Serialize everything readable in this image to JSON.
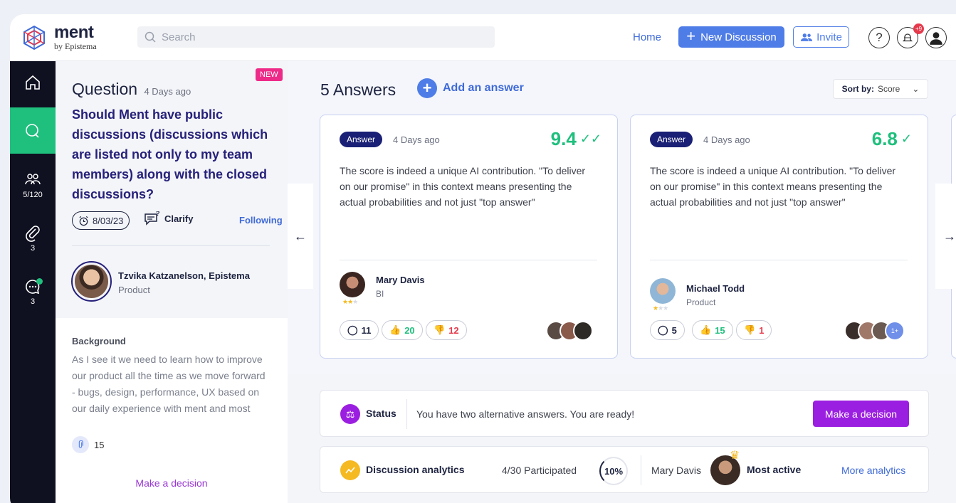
{
  "app": {
    "name": "ment",
    "sub": "by Epistema",
    "search_placeholder": "Search",
    "nav_home": "Home",
    "new_discussion": "New Discussion",
    "invite": "Invite",
    "help_icon": "?",
    "notification_count": "+9"
  },
  "sidebar": {
    "items": [
      {
        "name": "home-icon",
        "count": ""
      },
      {
        "name": "question-icon",
        "count": ""
      },
      {
        "name": "participants-icon",
        "count": "5/120"
      },
      {
        "name": "attachment-icon",
        "count": "3"
      },
      {
        "name": "chat-icon",
        "count": "3"
      }
    ]
  },
  "question": {
    "badge": "NEW",
    "heading": "Question",
    "time": "4 Days ago",
    "title": "Should Ment have public discussions (discussions which are listed not only to my team members) along with the  closed discussions?",
    "date": "8/03/23",
    "clarify": "Clarify",
    "following": "Following",
    "author_name": "Tzvika Katzanelson, Epistema",
    "author_role": "Product",
    "background_label": "Background",
    "background_text": "As I see it we need to learn how to improve our product all the time as we move forward - bugs, design, performance, UX based on our daily experience with ment and most",
    "attachments": "15",
    "make_decision": "Make a decision"
  },
  "answers": {
    "count_label": "5 Answers",
    "add_label": "Add an answer",
    "sort_label": "Sort by:",
    "sort_value": "Score",
    "cards": [
      {
        "tag": "Answer",
        "time": "4 Days ago",
        "score": "9.4",
        "text": "The score is indeed a unique AI contribution. \"To deliver on our promise\" in this context means presenting the actual probabilities and not just \"top answer\"",
        "author": "Mary Davis",
        "role": "BI",
        "comments": "11",
        "likes": "20",
        "dislikes": "12",
        "more": ""
      },
      {
        "tag": "Answer",
        "time": "4 Days ago",
        "score": "6.8",
        "text": "The score is indeed a unique AI contribution. \"To deliver on our promise\" in this context means presenting the actual probabilities and not just \"top answer\"",
        "author": "Michael Todd",
        "role": "Product",
        "comments": "5",
        "likes": "15",
        "dislikes": "1",
        "more": "1+"
      }
    ]
  },
  "status": {
    "label": "Status",
    "message": "You have two alternative answers. You are ready!",
    "button": "Make a decision"
  },
  "analytics": {
    "label": "Discussion analytics",
    "participated": "4/30  Participated",
    "percent": "10%",
    "most_active_name": "Mary Davis",
    "most_active_label": "Most active",
    "more": "More analytics"
  },
  "colors": {
    "accent": "#4f7de7",
    "green": "#1fbf7d",
    "purple": "#9b1fe0",
    "navy": "#1a2075"
  }
}
